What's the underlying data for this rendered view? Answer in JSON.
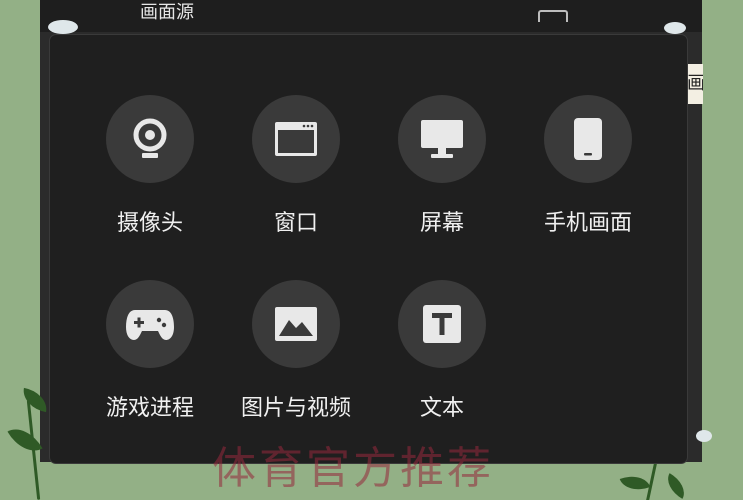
{
  "background": {
    "title_fragment": "画面源",
    "side_fragment": "画"
  },
  "sources": [
    {
      "label": "摄像头",
      "icon": "webcam-icon"
    },
    {
      "label": "窗口",
      "icon": "window-icon"
    },
    {
      "label": "屏幕",
      "icon": "monitor-icon"
    },
    {
      "label": "手机画面",
      "icon": "phone-icon"
    },
    {
      "label": "游戏进程",
      "icon": "gamepad-icon"
    },
    {
      "label": "图片与视频",
      "icon": "image-icon"
    },
    {
      "label": "文本",
      "icon": "text-icon"
    }
  ],
  "watermark": "体育官方推荐",
  "colors": {
    "popup_bg": "#1f1f1f",
    "icon_circle": "#3a3a3a",
    "icon_fill": "#e8e8e8",
    "page_bg": "#93b086"
  }
}
